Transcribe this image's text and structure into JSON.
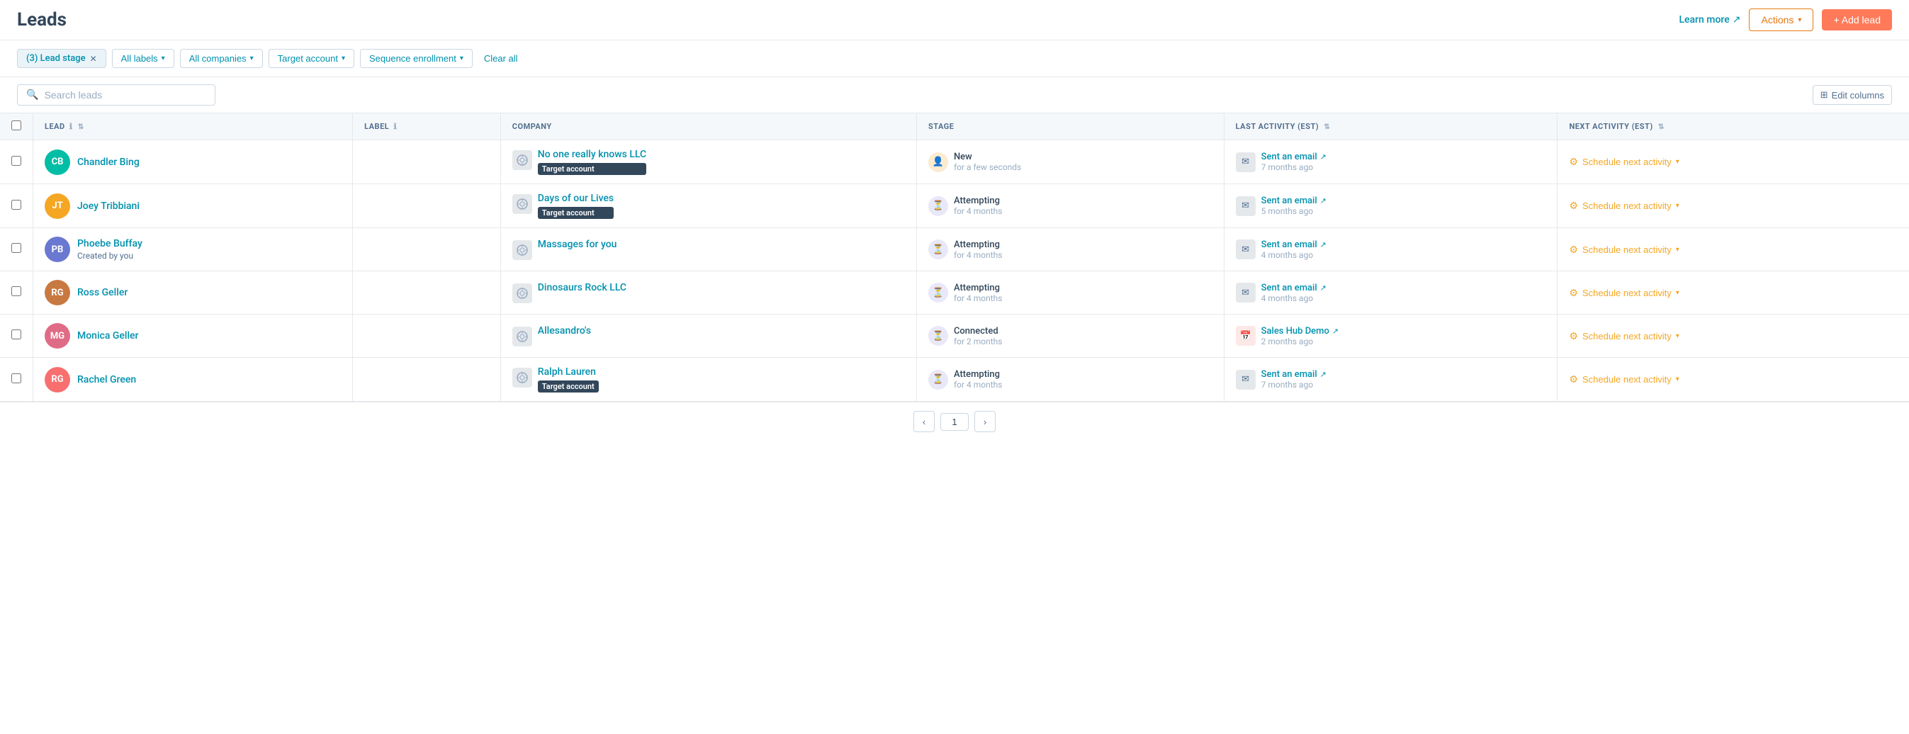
{
  "page": {
    "title": "Leads"
  },
  "header": {
    "learn_more": "Learn more",
    "actions_label": "Actions",
    "add_lead_label": "+ Add lead"
  },
  "filters": {
    "lead_stage": "(3) Lead stage",
    "all_labels": "All labels",
    "all_companies": "All companies",
    "target_account": "Target account",
    "sequence_enrollment": "Sequence enrollment",
    "clear_all": "Clear all"
  },
  "search": {
    "placeholder": "Search leads",
    "edit_columns": "Edit columns"
  },
  "table": {
    "columns": [
      {
        "key": "lead",
        "label": "LEAD",
        "has_info": true,
        "sortable": true
      },
      {
        "key": "label",
        "label": "LABEL",
        "has_info": true,
        "sortable": false
      },
      {
        "key": "company",
        "label": "COMPANY",
        "has_info": false,
        "sortable": false
      },
      {
        "key": "stage",
        "label": "STAGE",
        "has_info": false,
        "sortable": false
      },
      {
        "key": "last_activity",
        "label": "LAST ACTIVITY (EST)",
        "has_info": false,
        "sortable": true
      },
      {
        "key": "next_activity",
        "label": "NEXT ACTIVITY (EST)",
        "has_info": false,
        "sortable": true
      }
    ],
    "rows": [
      {
        "id": 1,
        "name": "Chandler Bing",
        "sub": "",
        "avatar_initials": "CB",
        "avatar_color": "teal",
        "label": "",
        "company_name": "No one really knows LLC",
        "company_badge": "Target account",
        "stage_type": "new",
        "stage_name": "New",
        "stage_duration": "for a few seconds",
        "last_activity_type": "email",
        "last_activity_name": "Sent an email",
        "last_activity_time": "7 months ago",
        "next_activity": "Schedule next activity"
      },
      {
        "id": 2,
        "name": "Joey Tribbiani",
        "sub": "",
        "avatar_initials": "JT",
        "avatar_color": "orange",
        "label": "",
        "company_name": "Days of our Lives",
        "company_badge": "Target account",
        "stage_type": "attempting",
        "stage_name": "Attempting",
        "stage_duration": "for 4 months",
        "last_activity_type": "email",
        "last_activity_name": "Sent an email",
        "last_activity_time": "5 months ago",
        "next_activity": "Schedule next activity"
      },
      {
        "id": 3,
        "name": "Phoebe Buffay",
        "sub": "Created by you",
        "avatar_initials": "PB",
        "avatar_color": "purple",
        "label": "",
        "company_name": "Massages for you",
        "company_badge": "",
        "stage_type": "attempting",
        "stage_name": "Attempting",
        "stage_duration": "for 4 months",
        "last_activity_type": "email",
        "last_activity_name": "Sent an email",
        "last_activity_time": "4 months ago",
        "next_activity": "Schedule next activity"
      },
      {
        "id": 4,
        "name": "Ross Geller",
        "sub": "",
        "avatar_initials": "RG",
        "avatar_color": "brown",
        "label": "",
        "company_name": "Dinosaurs Rock LLC",
        "company_badge": "",
        "stage_type": "attempting",
        "stage_name": "Attempting",
        "stage_duration": "for 4 months",
        "last_activity_type": "email",
        "last_activity_name": "Sent an email",
        "last_activity_time": "4 months ago",
        "next_activity": "Schedule next activity"
      },
      {
        "id": 5,
        "name": "Monica Geller",
        "sub": "",
        "avatar_initials": "MG",
        "avatar_color": "pink",
        "label": "",
        "company_name": "Allesandro's",
        "company_badge": "",
        "stage_type": "connected",
        "stage_name": "Connected",
        "stage_duration": "for 2 months",
        "last_activity_type": "calendar",
        "last_activity_name": "Sales Hub Demo",
        "last_activity_time": "2 months ago",
        "next_activity": "Schedule next activity"
      },
      {
        "id": 6,
        "name": "Rachel Green",
        "sub": "",
        "avatar_initials": "RG",
        "avatar_color": "coral",
        "label": "",
        "company_name": "Ralph Lauren",
        "company_badge": "Target account",
        "stage_type": "attempting",
        "stage_name": "Attempting",
        "stage_duration": "for 4 months",
        "last_activity_type": "email",
        "last_activity_name": "Sent an email",
        "last_activity_time": "7 months ago",
        "next_activity": "Schedule next activity"
      }
    ]
  },
  "pagination": {
    "prev": "‹",
    "current": "1",
    "next": "›"
  }
}
